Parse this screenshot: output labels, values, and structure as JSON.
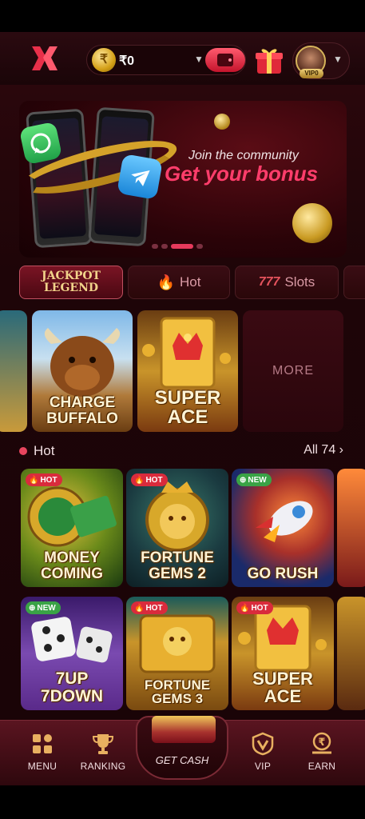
{
  "header": {
    "currency_symbol": "₹",
    "balance": "₹0",
    "vip_level": "VIP0"
  },
  "banner": {
    "subtitle": "Join the community",
    "title": "Get your bonus",
    "slide_count": 4,
    "active_slide": 2
  },
  "tabs": [
    {
      "label_line1": "JACKPOT",
      "label_line2": "LEGEND"
    },
    {
      "label": "Hot",
      "icon": "flame-icon"
    },
    {
      "label": "Slots",
      "icon": "slots-777-icon"
    }
  ],
  "jackpot_row": {
    "games": [
      {
        "name": "CHARGE BUFFALO"
      },
      {
        "name": "SUPER ACE"
      }
    ],
    "more_label": "MORE"
  },
  "hot_section": {
    "title": "Hot",
    "all_label": "All 74",
    "games": [
      {
        "name": "MONEY COMING",
        "tag": "HOT"
      },
      {
        "name": "FORTUNE GEMS 2",
        "tag": "HOT"
      },
      {
        "name": "GO RUSH",
        "tag": "NEW"
      },
      {
        "name": "7UP 7DOWN",
        "tag": "NEW"
      },
      {
        "name": "FORTUNE GEMS 3",
        "tag": "HOT"
      },
      {
        "name": "SUPER ACE",
        "tag": "HOT"
      }
    ]
  },
  "bottom_nav": {
    "menu": "MENU",
    "ranking": "RANKING",
    "get_cash": "GET CASH",
    "vip": "VIP",
    "earn": "EARN"
  },
  "colors": {
    "accent": "#e63a5c",
    "background": "#1e0508",
    "hot_tag": "#d92b3c",
    "new_tag": "#3aa346"
  }
}
